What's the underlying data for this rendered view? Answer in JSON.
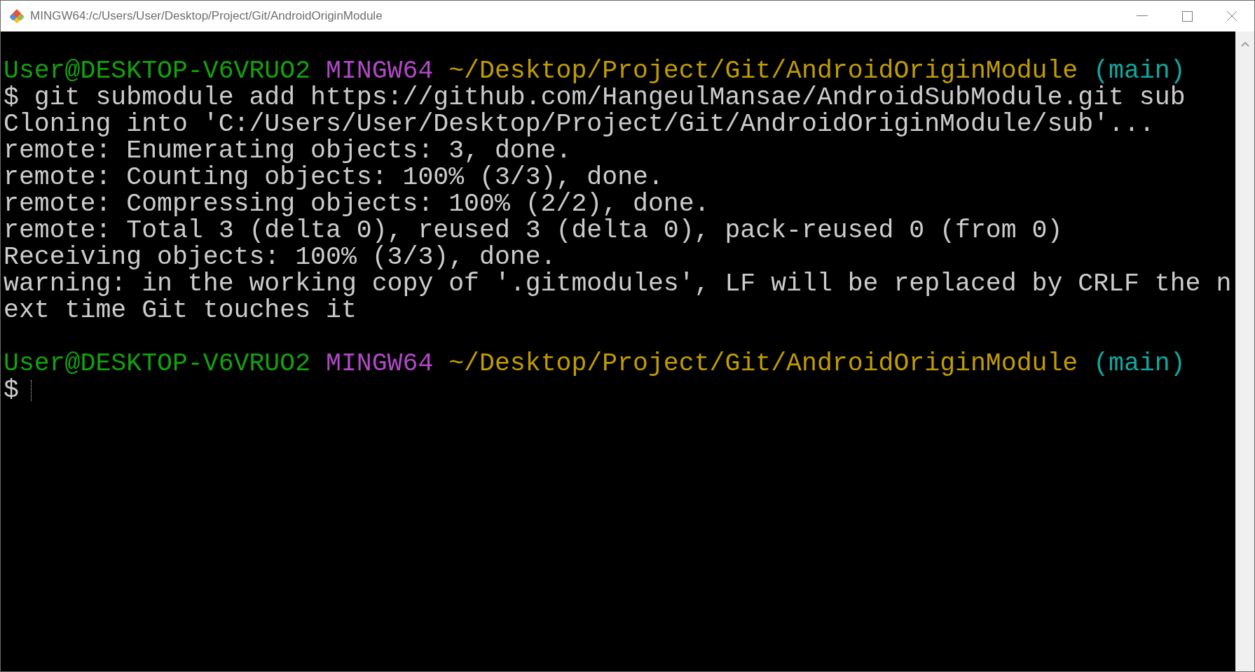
{
  "window": {
    "title": "MINGW64:/c/Users/User/Desktop/Project/Git/AndroidOriginModule"
  },
  "terminal": {
    "lines": [
      {
        "kind": "blank"
      },
      {
        "kind": "prompt",
        "user": "User@DESKTOP-V6VRUO2",
        "shell": "MINGW64",
        "path": "~/Desktop/Project/Git/AndroidOriginModule",
        "branch": "(main)"
      },
      {
        "kind": "command",
        "symbol": "$",
        "text": "git submodule add https://github.com/HangeulMansae/AndroidSubModule.git sub"
      },
      {
        "kind": "output",
        "text": "Cloning into 'C:/Users/User/Desktop/Project/Git/AndroidOriginModule/sub'..."
      },
      {
        "kind": "output",
        "text": "remote: Enumerating objects: 3, done."
      },
      {
        "kind": "output",
        "text": "remote: Counting objects: 100% (3/3), done."
      },
      {
        "kind": "output",
        "text": "remote: Compressing objects: 100% (2/2), done."
      },
      {
        "kind": "output",
        "text": "remote: Total 3 (delta 0), reused 3 (delta 0), pack-reused 0 (from 0)"
      },
      {
        "kind": "output",
        "text": "Receiving objects: 100% (3/3), done."
      },
      {
        "kind": "output",
        "text": "warning: in the working copy of '.gitmodules', LF will be replaced by CRLF the n"
      },
      {
        "kind": "output",
        "text": "ext time Git touches it"
      },
      {
        "kind": "blank"
      },
      {
        "kind": "prompt",
        "user": "User@DESKTOP-V6VRUO2",
        "shell": "MINGW64",
        "path": "~/Desktop/Project/Git/AndroidOriginModule",
        "branch": "(main)"
      },
      {
        "kind": "input",
        "symbol": "$"
      }
    ]
  }
}
